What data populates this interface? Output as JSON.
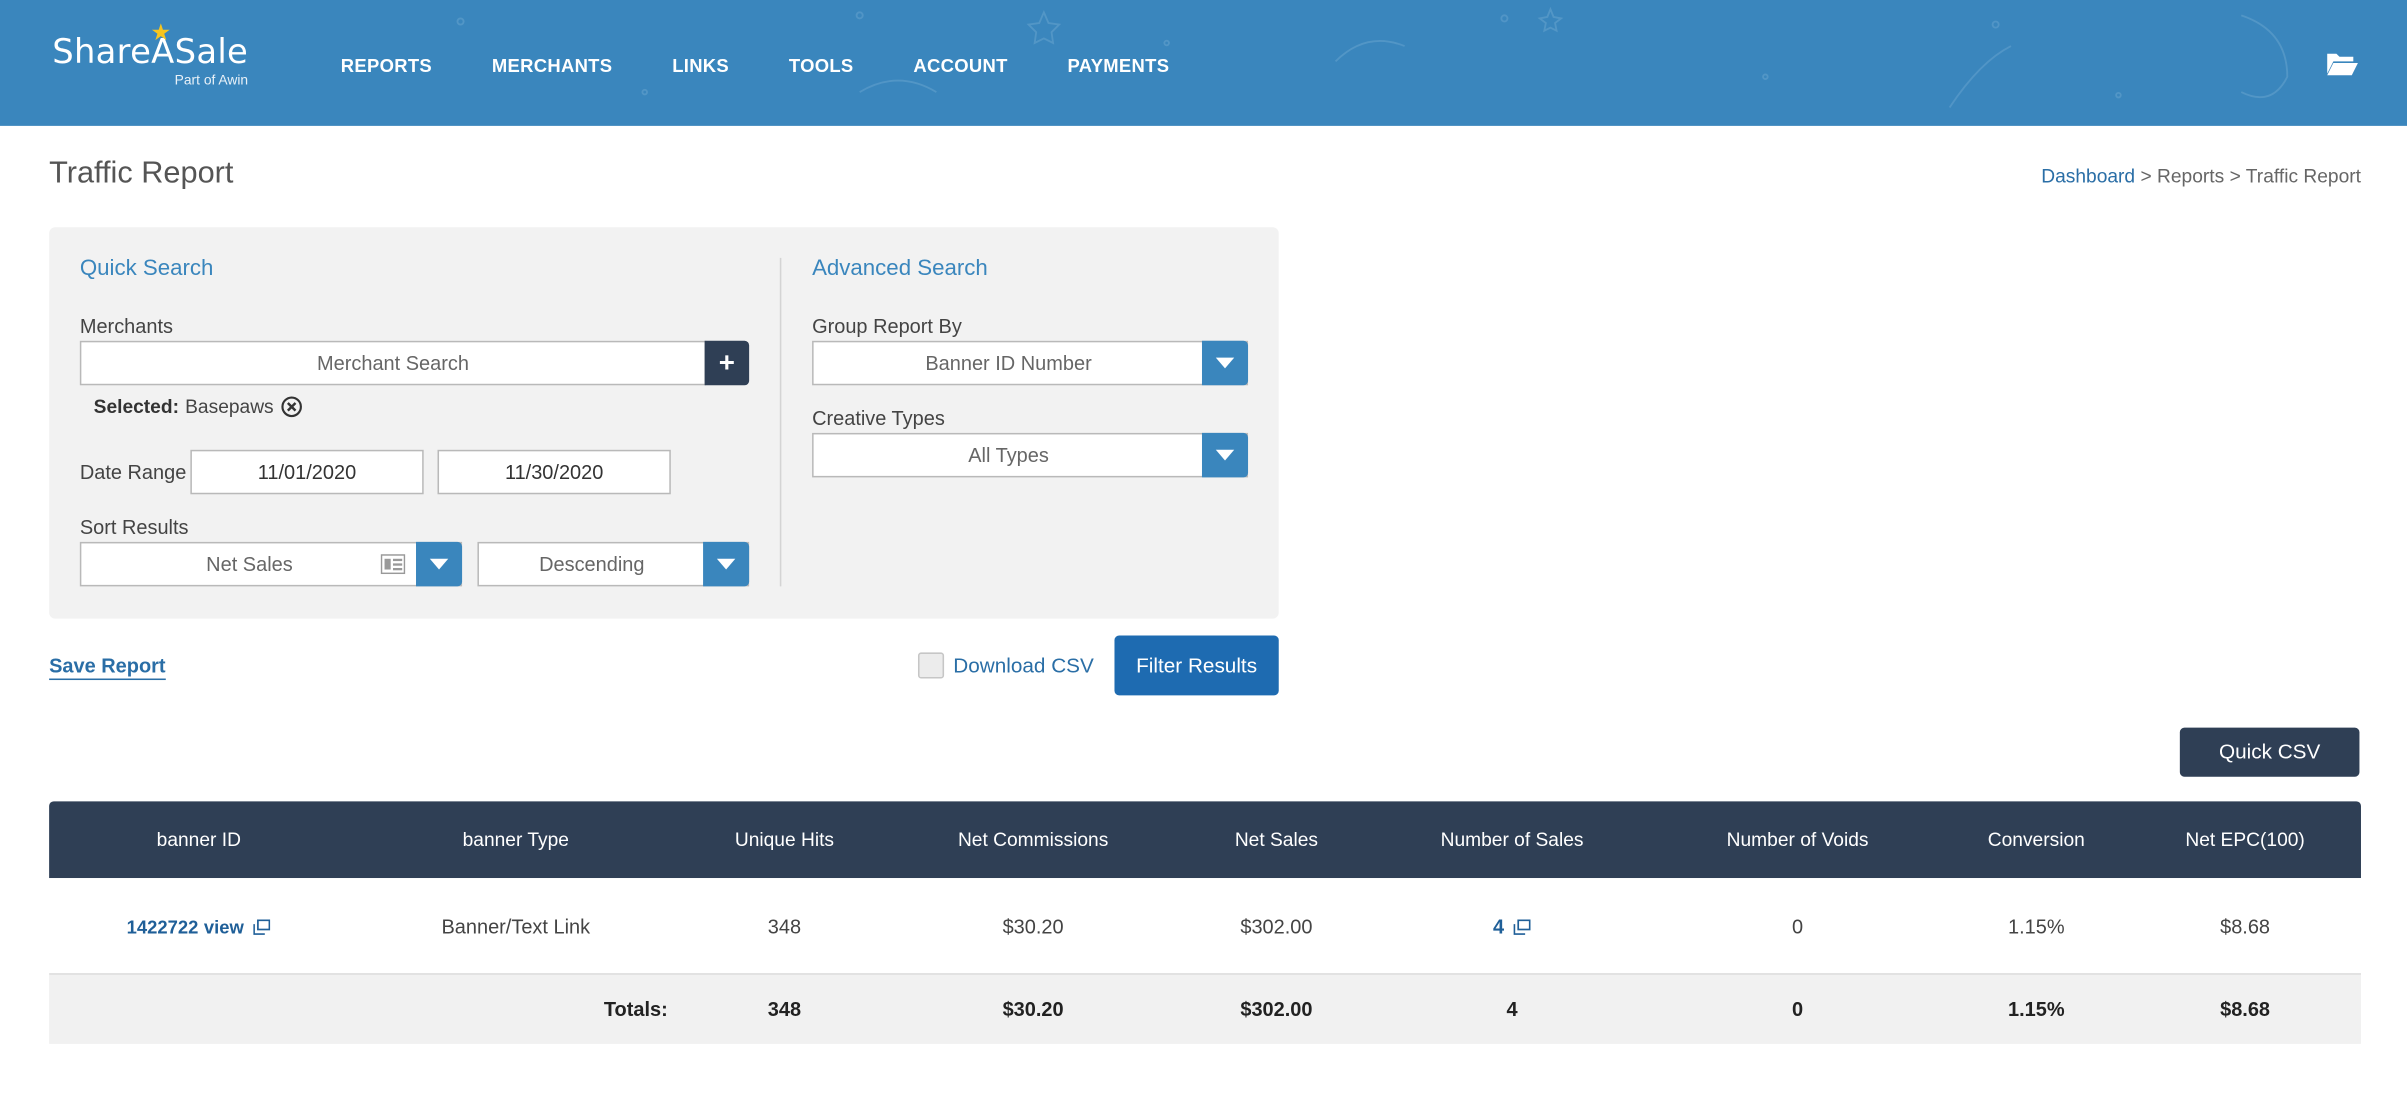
{
  "brand": {
    "name": "ShareASale",
    "sub": "Part of Awin",
    "accent": "#3a86bd",
    "dark": "#2f3f55",
    "star": "#f7c51d"
  },
  "nav": {
    "items": [
      "REPORTS",
      "MERCHANTS",
      "LINKS",
      "TOOLS",
      "ACCOUNT",
      "PAYMENTS"
    ]
  },
  "page": {
    "title": "Traffic Report"
  },
  "breadcrumb": {
    "dashboard": "Dashboard",
    "sep": ">",
    "reports": "Reports",
    "current": "Traffic Report"
  },
  "quick_search": {
    "title": "Quick Search",
    "merchants_label": "Merchants",
    "merchant_placeholder": "Merchant Search",
    "selected_label": "Selected:",
    "selected_value": "Basepaws",
    "date_range_label": "Date Range",
    "date_from": "11/01/2020",
    "date_to": "11/30/2020",
    "sort_label": "Sort Results",
    "sort_by": "Net Sales",
    "sort_order": "Descending"
  },
  "advanced_search": {
    "title": "Advanced Search",
    "group_label": "Group Report By",
    "group_value": "Banner ID Number",
    "creative_label": "Creative Types",
    "creative_value": "All Types"
  },
  "actions": {
    "save_report": "Save Report",
    "download_csv": "Download CSV",
    "filter_results": "Filter Results",
    "quick_csv": "Quick CSV"
  },
  "table": {
    "headers": [
      "banner ID",
      "banner Type",
      "Unique Hits",
      "Net Commissions",
      "Net Sales",
      "Number of Sales",
      "Number of Voids",
      "Conversion",
      "Net EPC(100)"
    ],
    "row": {
      "banner_id": "1422722",
      "view_label": "view",
      "banner_type": "Banner/Text Link",
      "unique_hits": "348",
      "net_commissions": "$30.20",
      "net_sales": "$302.00",
      "number_of_sales": "4",
      "number_of_voids": "0",
      "conversion": "1.15%",
      "net_epc": "$8.68"
    },
    "totals": {
      "label": "Totals:",
      "unique_hits": "348",
      "net_commissions": "$30.20",
      "net_sales": "$302.00",
      "number_of_sales": "4",
      "number_of_voids": "0",
      "conversion": "1.15%",
      "net_epc": "$8.68"
    }
  }
}
